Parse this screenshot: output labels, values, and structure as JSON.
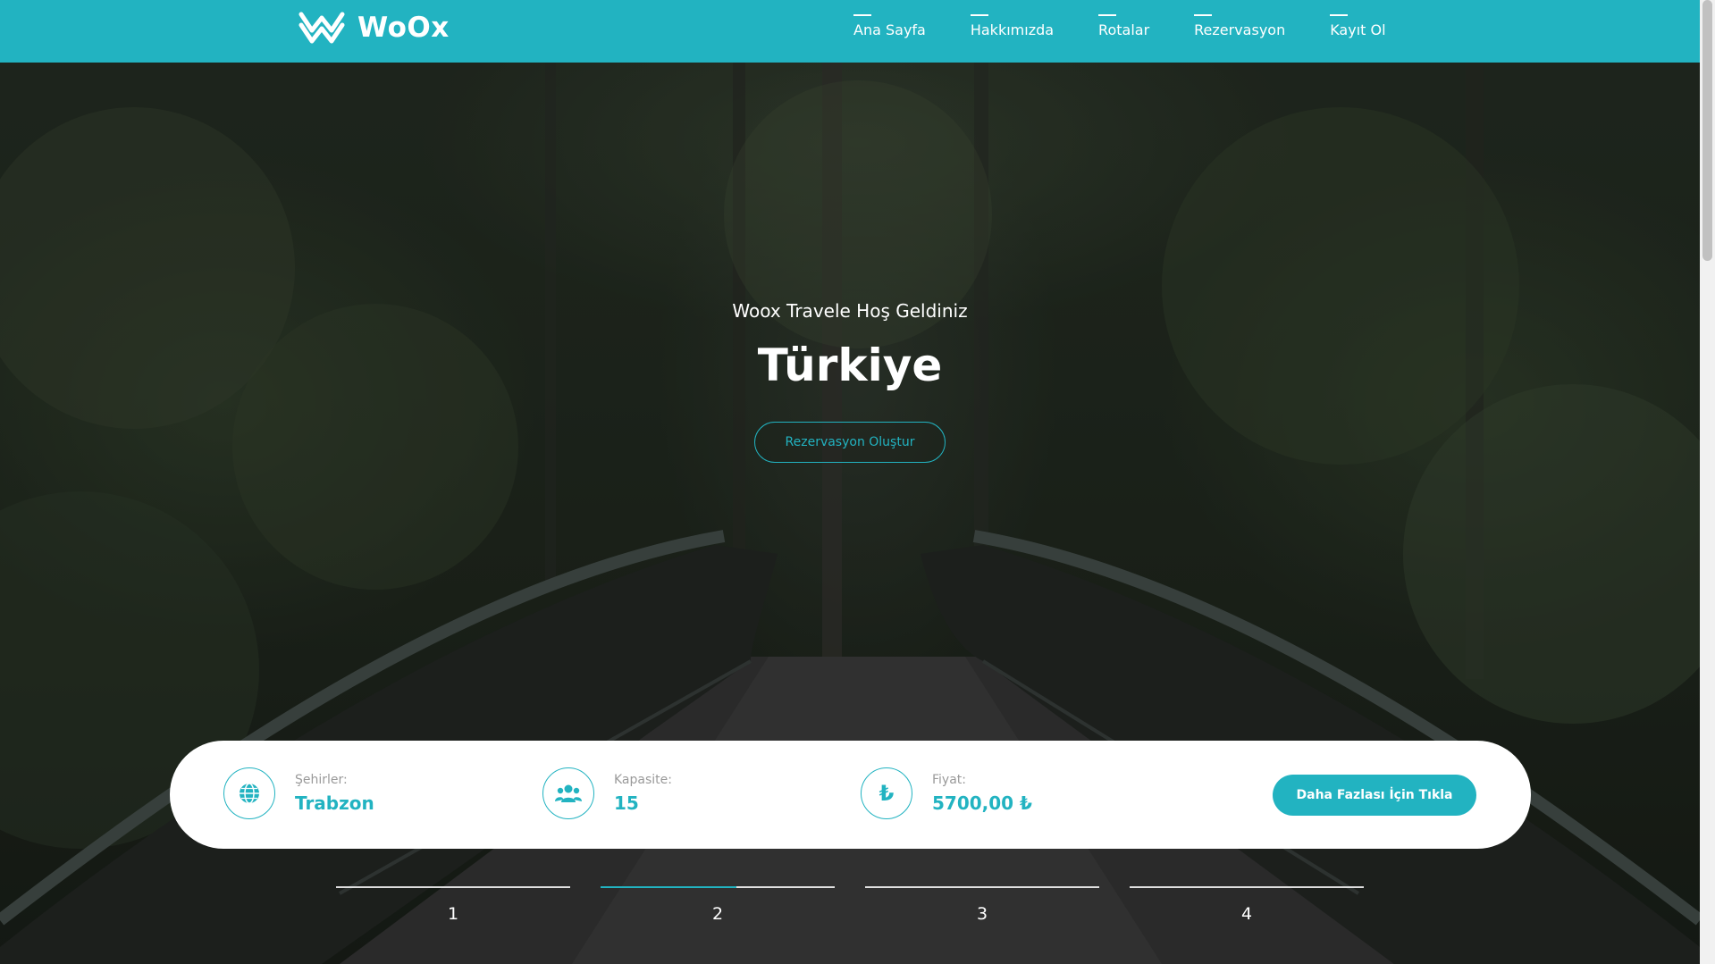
{
  "brand": {
    "name": "WoOx",
    "accent": "#22b3c1"
  },
  "nav": {
    "items": [
      "Ana Sayfa",
      "Hakkımızda",
      "Rotalar",
      "Rezervasyon",
      "Kayıt Ol"
    ]
  },
  "hero": {
    "welcome": "Woox Travele Hoş Geldiniz",
    "country": "Türkiye",
    "cta": "Rezervasyon Oluştur"
  },
  "info": {
    "city": {
      "label": "Şehirler:",
      "value": "Trabzon",
      "icon": "globe-icon"
    },
    "capacity": {
      "label": "Kapasite:",
      "value": "15",
      "icon": "users-icon"
    },
    "price": {
      "label": "Fiyat:",
      "value": "5700,00 ₺",
      "icon": "lira-icon"
    },
    "more_button": "Daha Fazlası İçin Tıkla"
  },
  "slides": {
    "items": [
      "1",
      "2",
      "3",
      "4"
    ],
    "active": 1,
    "active_progress": 0.58
  }
}
